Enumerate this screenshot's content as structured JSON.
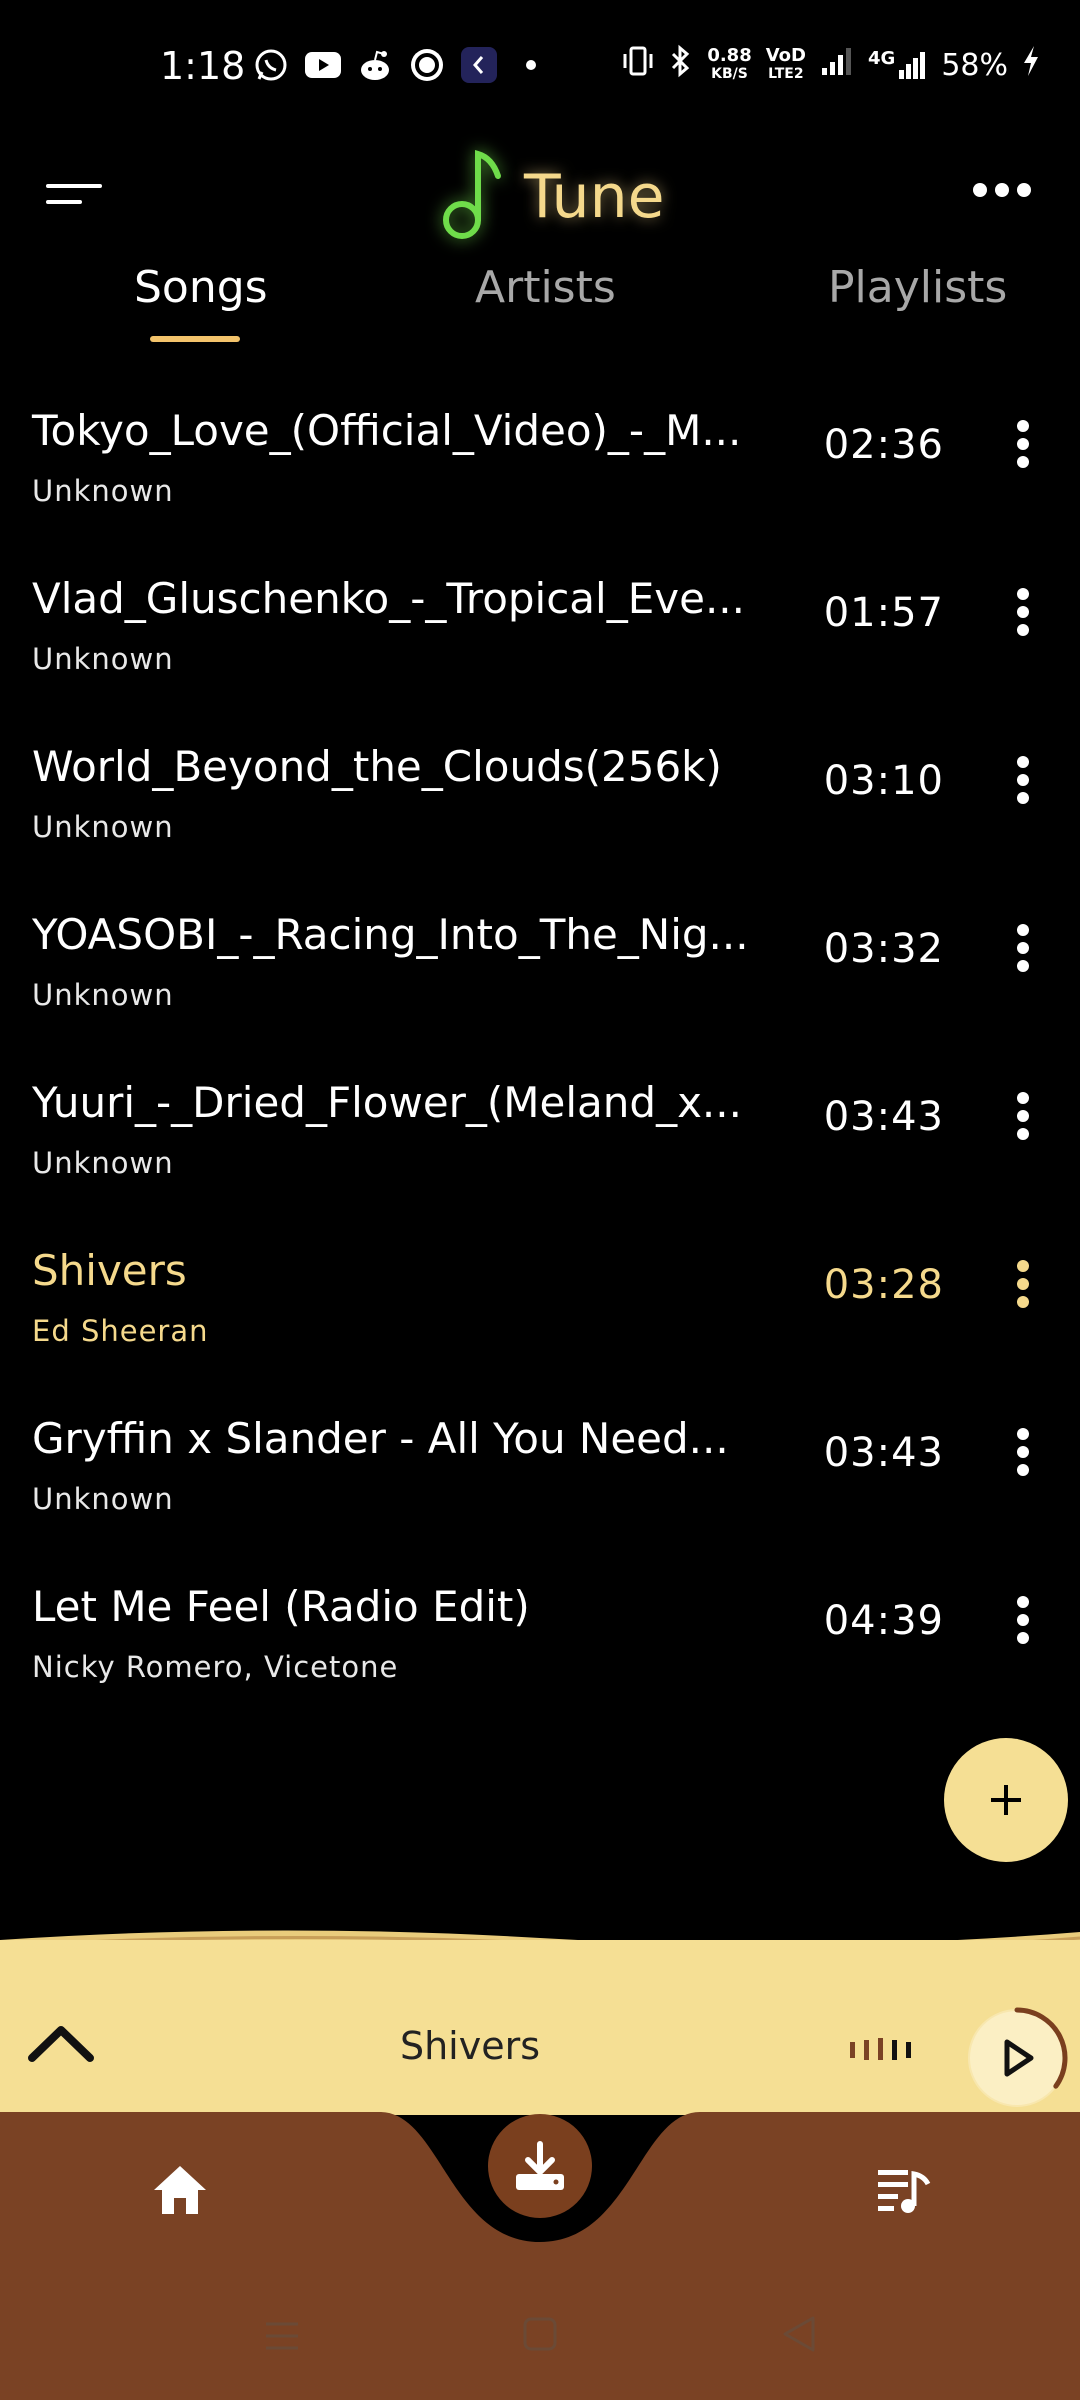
{
  "status_bar": {
    "time": "1:18",
    "net_speed_value": "0.88",
    "net_speed_unit": "KB/S",
    "volte_top": "VoD",
    "volte_bottom": "LTE2",
    "network_type": "4G",
    "battery": "58%",
    "icons": [
      "whatsapp-icon",
      "youtube-icon",
      "reddit-icon",
      "circle-app-icon",
      "app-icon",
      "dot-icon",
      "vibrate-icon",
      "bluetooth-icon",
      "signal-icon",
      "signal-icon-2",
      "charging-icon"
    ]
  },
  "header": {
    "app_title": "Tune",
    "logo_icon": "music-note-icon",
    "menu_icon": "hamburger-menu-icon",
    "more_icon": "more-horizontal-icon"
  },
  "tabs": [
    {
      "label": "Songs",
      "active": true
    },
    {
      "label": "Artists",
      "active": false
    },
    {
      "label": "Playlists",
      "active": false
    }
  ],
  "songs": [
    {
      "title": "Tokyo_Love_(Official_Video)_-_M...",
      "artist": "Unknown",
      "duration": "02:36"
    },
    {
      "title": "Vlad_Gluschenko_-_Tropical_Eve...",
      "artist": "Unknown",
      "duration": "01:57"
    },
    {
      "title": "World_Beyond_the_Clouds(256k)",
      "artist": "Unknown",
      "duration": "03:10"
    },
    {
      "title": "YOASOBI_-_Racing_Into_The_Nig...",
      "artist": "Unknown",
      "duration": "03:32"
    },
    {
      "title": "Yuuri_-_Dried_Flower_(Meland_x...",
      "artist": "Unknown",
      "duration": "03:43"
    },
    {
      "title": "Shivers",
      "artist": "Ed Sheeran",
      "duration": "03:28",
      "current": true
    },
    {
      "title": "Gryffin x Slander - All You Need...",
      "artist": "Unknown",
      "duration": "03:43"
    },
    {
      "title": "Let Me Feel (Radio Edit)",
      "artist": "Nicky Romero, Vicetone",
      "duration": "04:39"
    }
  ],
  "fab": {
    "icon": "plus-icon"
  },
  "mini_player": {
    "now_playing": "Shivers",
    "progress_fraction": 0.35,
    "expand_icon": "chevron-up-icon",
    "eq_icon": "equalizer-icon",
    "play_icon": "play-icon"
  },
  "bottom_nav": {
    "items": [
      "home-icon",
      "download-icon",
      "queue-music-icon"
    ]
  },
  "colors": {
    "accent": "#f5d98c",
    "player_bg": "#f5df94",
    "nav_bg": "#7a4224",
    "background": "#000000"
  }
}
